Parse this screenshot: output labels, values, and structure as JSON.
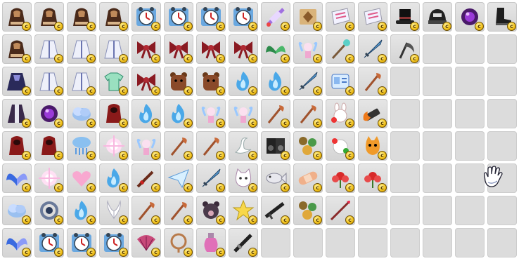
{
  "inventory": {
    "columns": 16,
    "rows": 8,
    "coin_glyph": "c",
    "slot_color": "#dcdcdc",
    "coin_color": "#f2c21a",
    "rows_data": [
      [
        "hooded-coat",
        "hooded-coat",
        "hooded-coat",
        "hooded-coat",
        "alarm-clock",
        "alarm-clock",
        "alarm-clock",
        "alarm-clock",
        "magic-scroll",
        "treasure-map",
        "ticket",
        "ticket",
        "top-hat",
        "black-cap",
        "dark-orb",
        "black-boot"
      ],
      [
        "hooded-coat",
        "white-robe",
        "white-robe",
        "white-robe",
        "red-bow",
        "red-bow",
        "red-bow",
        "red-bow",
        "green-wings",
        "fairy-sprite",
        "crystal-staff",
        "blue-sword",
        "scythe",
        null,
        null,
        null
      ],
      [
        "dark-cape",
        "white-robe",
        "white-robe",
        "green-shirt",
        "red-bow",
        "bear-backpack",
        "bear-backpack",
        "blue-flame",
        "blue-flame",
        "blue-sword",
        "id-card",
        "magic-staff",
        null,
        null,
        null,
        null
      ],
      [
        "dark-robe",
        "dark-orb",
        "blue-cloud",
        "red-hood",
        "blue-flame",
        "blue-flame",
        "fairy-sprite",
        "fairy-sprite",
        "magic-staff",
        "magic-staff",
        "flower-bunny",
        "fire-cannon",
        null,
        null,
        null,
        null
      ],
      [
        "red-hood",
        "red-hood",
        "cloud-rain",
        "light-burst",
        "fairy-sprite",
        "magic-staff",
        "magic-staff",
        "white-swan",
        "speaker",
        "flower-mix",
        "rabbit-flowers",
        "orange-cat",
        null,
        null,
        null,
        null
      ],
      [
        "blue-wings",
        "light-burst",
        "pink-heart",
        "blue-flame",
        "red-sword",
        "paper-plane",
        "blue-sword",
        "white-cat",
        "fish",
        "band-aid",
        "red-flower",
        "red-flower",
        null,
        null,
        null,
        null
      ],
      [
        "blue-cloud",
        "ring-orb",
        "blue-flame",
        "white-wings",
        "magic-staff",
        "magic-staff",
        "dark-bear",
        "yellow-star",
        "black-rifle",
        "flower-mix",
        "red-spear",
        null,
        null,
        null,
        null,
        null
      ],
      [
        "blue-wings",
        "alarm-clock",
        "alarm-clock",
        "alarm-clock",
        "pink-fan",
        "rope-ring",
        "pink-potion",
        "dark-sword",
        null,
        null,
        null,
        null,
        null,
        null,
        null,
        null
      ]
    ]
  },
  "cursor": {
    "icon": "white-glove-icon"
  }
}
